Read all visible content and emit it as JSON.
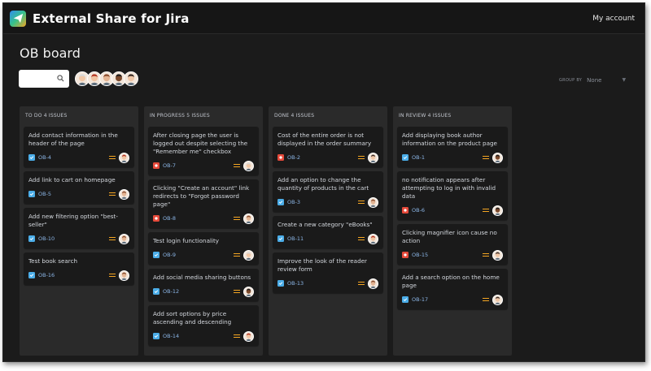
{
  "app": {
    "title": "External Share for Jira",
    "account_label": "My account"
  },
  "board": {
    "title": "OB board"
  },
  "search": {
    "placeholder": ""
  },
  "group_by": {
    "label": "GROUP BY",
    "value": "None"
  },
  "colors": {
    "task": "#4bade8",
    "bug": "#e5493a",
    "priority": "#f5a623"
  },
  "avatars": [
    {
      "skin": "#f1c7a5",
      "hair": "#d8d8d8"
    },
    {
      "skin": "#f0c4a2",
      "hair": "#b3331f"
    },
    {
      "skin": "#e3b493",
      "hair": "#8a4a2a"
    },
    {
      "skin": "#7c4a2d",
      "hair": "#1e1a18"
    },
    {
      "skin": "#efc6a6",
      "hair": "#3a2a22"
    }
  ],
  "columns": [
    {
      "header": "TO DO 4 ISSUES",
      "cards": [
        {
          "summary": "Add contact information in the header of the page",
          "key": "OB-4",
          "type": "task",
          "avatar": 1
        },
        {
          "summary": "Add link to cart on homepage",
          "key": "OB-5",
          "type": "task",
          "avatar": 2
        },
        {
          "summary": "Add new filtering option \"best-seller\"",
          "key": "OB-10",
          "type": "task",
          "avatar": 2
        },
        {
          "summary": "Test book search",
          "key": "OB-16",
          "type": "task",
          "avatar": 2
        }
      ]
    },
    {
      "header": "IN PROGRESS 5 ISSUES",
      "cards": [
        {
          "summary": "After closing page the user is logged out despite selecting the \"Remember me\" checkbox",
          "key": "OB-7",
          "type": "bug",
          "avatar": 5
        },
        {
          "summary": "Clicking \"Create an account\" link redirects to \"Forgot password page\"",
          "key": "OB-8",
          "type": "bug",
          "avatar": 2
        },
        {
          "summary": "Test login functionality",
          "key": "OB-9",
          "type": "task",
          "avatar": 0
        },
        {
          "summary": "Add social media sharing buttons",
          "key": "OB-12",
          "type": "task",
          "avatar": 3
        },
        {
          "summary": "Add sort options by price ascending and descending",
          "key": "OB-14",
          "type": "task",
          "avatar": 1
        }
      ]
    },
    {
      "header": "DONE 4 ISSUES",
      "cards": [
        {
          "summary": "Cost of the entire order is not displayed in the order summary",
          "key": "OB-2",
          "type": "bug",
          "avatar": 4
        },
        {
          "summary": "Add an option to change the quantity of products in the cart",
          "key": "OB-3",
          "type": "task",
          "avatar": 2
        },
        {
          "summary": "Create a new category \"eBooks\"",
          "key": "OB-11",
          "type": "task",
          "avatar": 1
        },
        {
          "summary": "Improve the look of the reader review form",
          "key": "OB-13",
          "type": "task",
          "avatar": 2
        }
      ]
    },
    {
      "header": "IN REVIEW 4 ISSUES",
      "cards": [
        {
          "summary": "Add displaying book author information on the product page",
          "key": "OB-1",
          "type": "task",
          "avatar": 3
        },
        {
          "summary": "no notification appears after attempting to log in with invalid data",
          "key": "OB-6",
          "type": "bug",
          "avatar": 3
        },
        {
          "summary": "Clicking magnifier icon cause no action",
          "key": "OB-15",
          "type": "bug",
          "avatar": 4
        },
        {
          "summary": "Add a search option on the home page",
          "key": "OB-17",
          "type": "task",
          "avatar": 4
        }
      ]
    }
  ]
}
